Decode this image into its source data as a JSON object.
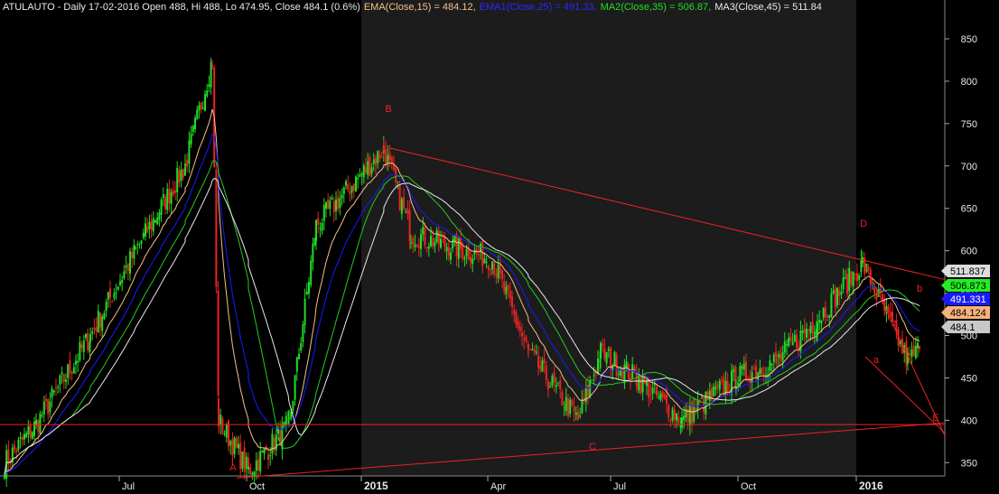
{
  "header": {
    "symbol_info": "ATULAUTO - Daily 17-02-2016 Open 488, Hi 488, Lo 474.95, Close 484.1 (0.6%)",
    "ema15": "EMA(Close,15) = 484.12,",
    "ema25": "EMA1(Close,25) = 491.33,",
    "ma35": "MA2(Close,35) = 506.87,",
    "ma45": "MA3(Close,45) = 511.84"
  },
  "colors": {
    "background": "#000000",
    "text": "#e8e8e8",
    "up_candle": "#22dd22",
    "down_candle": "#ee2222",
    "ema15": "#f5c08a",
    "ema25": "#1a1aff",
    "ma35": "#22cc22",
    "ma45": "#e8e8e8",
    "trendline": "#ee2222"
  },
  "chart_data": {
    "type": "candlestick",
    "y_ticks": [
      350,
      400,
      450,
      500,
      550,
      600,
      650,
      700,
      750,
      800,
      850
    ],
    "ylim": [
      315,
      870
    ],
    "x_ticks": [
      "Jul",
      "Oct",
      "2015",
      "Apr",
      "Jul",
      "Oct",
      "2016"
    ],
    "price_anchors": [
      [
        "May-2014",
        350
      ],
      [
        "Jun-2014",
        400
      ],
      [
        "Jul-2014",
        500
      ],
      [
        "Aug-2014",
        600
      ],
      [
        "Aug-2014",
        700
      ],
      [
        "Sep-2014",
        825
      ],
      [
        "Sep-2014",
        400
      ],
      [
        "Oct-2014",
        340
      ],
      [
        "Nov-2014",
        395
      ],
      [
        "Dec-2014",
        630
      ],
      [
        "Jan-2015",
        720
      ],
      [
        "Feb-2015",
        620
      ],
      [
        "Apr-2015",
        590
      ],
      [
        "May-2015",
        480
      ],
      [
        "Jun-2015",
        400
      ],
      [
        "Jul-2015",
        480
      ],
      [
        "Aug-2015",
        450
      ],
      [
        "Sep-2015",
        400
      ],
      [
        "Oct-2015",
        450
      ],
      [
        "Nov-2015",
        470
      ],
      [
        "Dec-2015",
        520
      ],
      [
        "Jan-2016",
        585
      ],
      [
        "Feb-2016",
        470
      ],
      [
        "Feb-2016",
        484.1
      ]
    ],
    "horizontal_line": 395,
    "trendlines": [
      {
        "from": "A",
        "to": "2016-end",
        "y_from": 332,
        "y_to": 397
      },
      {
        "from": "B",
        "to": "2016-end",
        "y_from": 721,
        "y_to": 566
      },
      {
        "from": "D",
        "to": "E",
        "y_from": 585,
        "y_to": 382
      },
      {
        "from": "a",
        "to": "E",
        "y_from": 475,
        "y_to": 385
      }
    ],
    "pattern_labels": [
      "A",
      "B",
      "C",
      "D",
      "E",
      "a",
      "b"
    ],
    "value_tags": [
      {
        "label": "511.837",
        "value": 511.837,
        "bg": "#dcdcdc",
        "fg": "#000000"
      },
      {
        "label": "506.873",
        "value": 506.873,
        "bg": "#22ee22",
        "fg": "#000000"
      },
      {
        "label": "491.331",
        "value": 491.331,
        "bg": "#1a1aff",
        "fg": "#ffffff"
      },
      {
        "label": "484.124",
        "value": 484.124,
        "bg": "#f6b27a",
        "fg": "#000000"
      },
      {
        "label": "484.1",
        "value": 484.1,
        "bg": "#c8c8c8",
        "fg": "#000000"
      }
    ],
    "series": [
      {
        "name": "EMA(Close,15)",
        "last": 484.12
      },
      {
        "name": "EMA1(Close,25)",
        "last": 491.33
      },
      {
        "name": "MA2(Close,35)",
        "last": 506.87
      },
      {
        "name": "MA3(Close,45)",
        "last": 511.84
      }
    ]
  }
}
